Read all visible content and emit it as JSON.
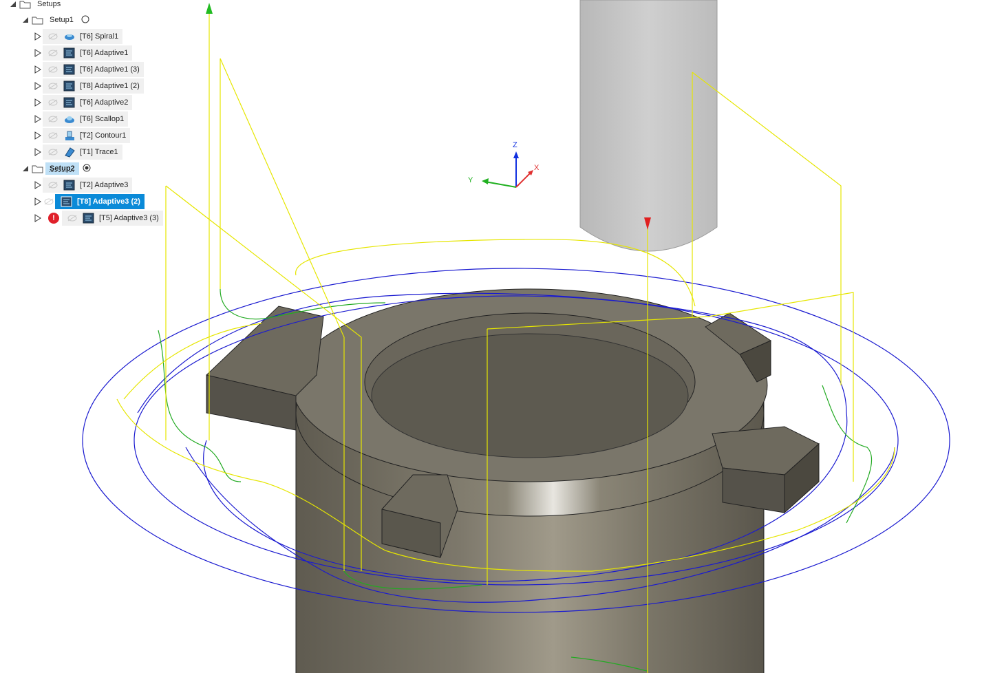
{
  "tree": {
    "root": {
      "label": "Setups"
    },
    "setups": [
      {
        "label": "Setup1",
        "active": false,
        "operations": [
          {
            "label": "[T6] Spiral1",
            "icon": "spiral-icon"
          },
          {
            "label": "[T6] Adaptive1",
            "icon": "adaptive-icon"
          },
          {
            "label": "[T6] Adaptive1 (3)",
            "icon": "adaptive-icon"
          },
          {
            "label": "[T8] Adaptive1 (2)",
            "icon": "adaptive-icon"
          },
          {
            "label": "[T6] Adaptive2",
            "icon": "adaptive-icon"
          },
          {
            "label": "[T6] Scallop1",
            "icon": "scallop-icon"
          },
          {
            "label": "[T2] Contour1",
            "icon": "contour-icon"
          },
          {
            "label": "[T1] Trace1",
            "icon": "trace-icon"
          }
        ]
      },
      {
        "label": "Setup2",
        "active": true,
        "operations": [
          {
            "label": "[T2] Adaptive3",
            "icon": "adaptive-icon"
          },
          {
            "label": "[T8] Adaptive3 (2)",
            "icon": "adaptive-icon",
            "selected": true
          },
          {
            "label": "[T5] Adaptive3 (3)",
            "icon": "adaptive-icon",
            "error": true
          }
        ]
      }
    ]
  },
  "triad": {
    "z": "Z",
    "x": "X",
    "y": "Y"
  },
  "colors": {
    "selection": "#0a8ad8",
    "toolpath_cut": "#1a1ad0",
    "toolpath_rapid": "#e6e600",
    "toolpath_lead": "#22aa22",
    "part": "#7b776a",
    "tool": "#c4c4c4",
    "error": "#e0202a"
  }
}
